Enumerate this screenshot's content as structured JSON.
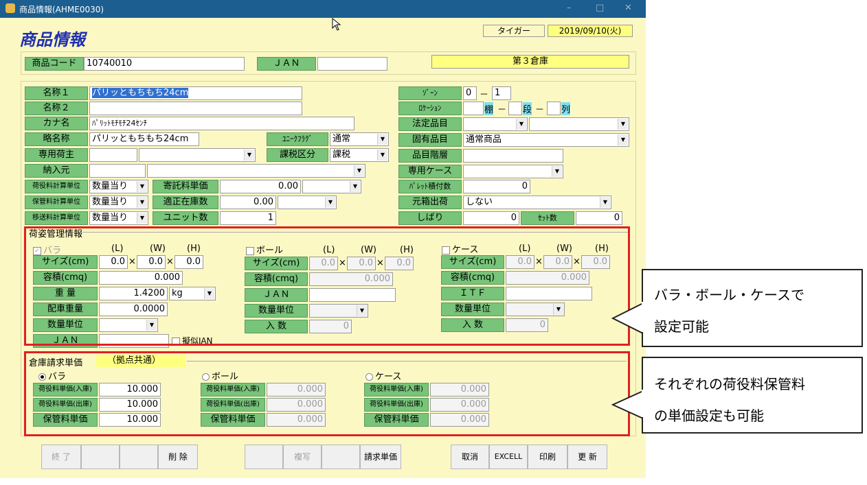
{
  "window": {
    "title": "商品情報(AHME0030)",
    "controls": {
      "min": "–",
      "max": "□",
      "close": "✕"
    }
  },
  "header": {
    "heading": "商品情報",
    "user": "タイガー",
    "date": "2019/09/10(火)"
  },
  "top": {
    "code_label": "商品コード",
    "code_value": "10740010",
    "jan_label": "ＪＡＮ",
    "jan_value": "",
    "warehouse": "第３倉庫"
  },
  "left": {
    "name1_label": "名称１",
    "name1": "パリッともちもち24cm",
    "name2_label": "名称２",
    "name2": "",
    "kana_label": "カナ名",
    "kana": "ﾊﾟﾘｯﾄﾓﾁﾓﾁ24ｾﾝﾁ",
    "short_label": "略名称",
    "short": "パリッともちもち24cm",
    "unique_label": "ﾕﾆｰｸﾌﾗｸﾞ",
    "unique": "通常",
    "owner_label": "専用荷主",
    "owner": "",
    "tax_label": "課税区分",
    "tax": "課税",
    "supplier_label": "納入元",
    "supplier": "",
    "cargo_calc_label": "荷役料計算単位",
    "cargo_calc": "数量当り",
    "consign_label": "寄託料単価",
    "consign": "0.00",
    "storage_calc_label": "保管料計算単位",
    "storage_calc": "数量当り",
    "proper_label": "適正在庫数",
    "proper": "0.00",
    "move_calc_label": "移送料計算単位",
    "move_calc": "数量当り",
    "unit_label": "ユニット数",
    "unit": "1"
  },
  "right": {
    "zone_label": "ｿﾞｰﾝ",
    "zone_a": "0",
    "zone_sep": "－",
    "zone_b": "1",
    "loc_label": "ﾛｹｰｼｮﾝ",
    "shelf": "棚",
    "tier": "段",
    "col": "列",
    "loc_sep": "－",
    "legal_label": "法定品目",
    "legal": "",
    "fixed_label": "固有品目",
    "fixed": "通常商品",
    "hier_label": "品目階層",
    "hier": "",
    "case_label": "専用ケース",
    "case": "",
    "pallet_label": "ﾊﾟﾚｯﾄ積付数",
    "pallet": "0",
    "outer_label": "元箱出荷",
    "outer": "しない",
    "shibari_label": "しばり",
    "shibari": "0",
    "set_label": "ｾｯﾄ数",
    "set": "0"
  },
  "packaging": {
    "title": "荷姿管理情報",
    "dims": {
      "l": "(L)",
      "w": "(W)",
      "h": "(H)",
      "x": "×"
    },
    "bara": {
      "label": "バラ",
      "size_label": "サイズ(cm)",
      "l": "0.0",
      "w": "0.0",
      "h": "0.0",
      "vol_label": "容積(cmq)",
      "vol": "0.000",
      "weight_label": "重 量",
      "weight": "1.4200",
      "weight_unit": "kg",
      "dispatch_label": "配車重量",
      "dispatch": "0.0000",
      "qty_label": "数量単位",
      "qty": "",
      "jan_label": "ＪＡＮ",
      "jan": "",
      "pseudo": "擬似JAN"
    },
    "ball": {
      "label": "ボール",
      "size_label": "サイズ(cm)",
      "l": "0.0",
      "w": "0.0",
      "h": "0.0",
      "vol_label": "容積(cmq)",
      "vol": "0.000",
      "jan_label": "ＪＡＮ",
      "jan": "",
      "qty_label": "数量単位",
      "qty": "",
      "in_label": "入 数",
      "in": "0"
    },
    "case": {
      "label": "ケース",
      "size_label": "サイズ(cm)",
      "l": "0.0",
      "w": "0.0",
      "h": "0.0",
      "vol_label": "容積(cmq)",
      "vol": "0.000",
      "itf_label": "ＩＴＦ",
      "itf": "",
      "qty_label": "数量単位",
      "qty": "",
      "in_label": "入 数",
      "in": "0"
    }
  },
  "billing": {
    "title": "倉庫請求単価",
    "shared": "（拠点共通）",
    "bara": {
      "label": "バラ",
      "in_label": "荷役料単価(入庫)",
      "in": "10.000",
      "out_label": "荷役料単価(出庫)",
      "out": "10.000",
      "store_label": "保管料単価",
      "store": "10.000"
    },
    "ball": {
      "label": "ボール",
      "in_label": "荷役料単価(入庫)",
      "in": "0.000",
      "out_label": "荷役料単価(出庫)",
      "out": "0.000",
      "store_label": "保管料単価",
      "store": "0.000"
    },
    "case": {
      "label": "ケース",
      "in_label": "荷役料単価(入庫)",
      "in": "0.000",
      "out_label": "荷役料単価(出庫)",
      "out": "0.000",
      "store_label": "保管料単価",
      "store": "0.000"
    }
  },
  "buttons": {
    "end": "終 了",
    "delete": "削 除",
    "copy": "複写",
    "bill": "請求単価",
    "cancel": "取消",
    "excel": "EXCELL",
    "print": "印刷",
    "update": "更 新"
  },
  "callouts": {
    "c1_line1": "バラ・ボール・ケースで",
    "c1_line2": "設定可能",
    "c2_line1": "それぞれの荷役料保管料",
    "c2_line2": "の単価設定も可能"
  },
  "colors": {
    "background": "#fcf8c4",
    "label": "#78c47a",
    "highlight": "#ffff80",
    "titlebar": "#1b5e8f",
    "annotation": "#e02020"
  }
}
